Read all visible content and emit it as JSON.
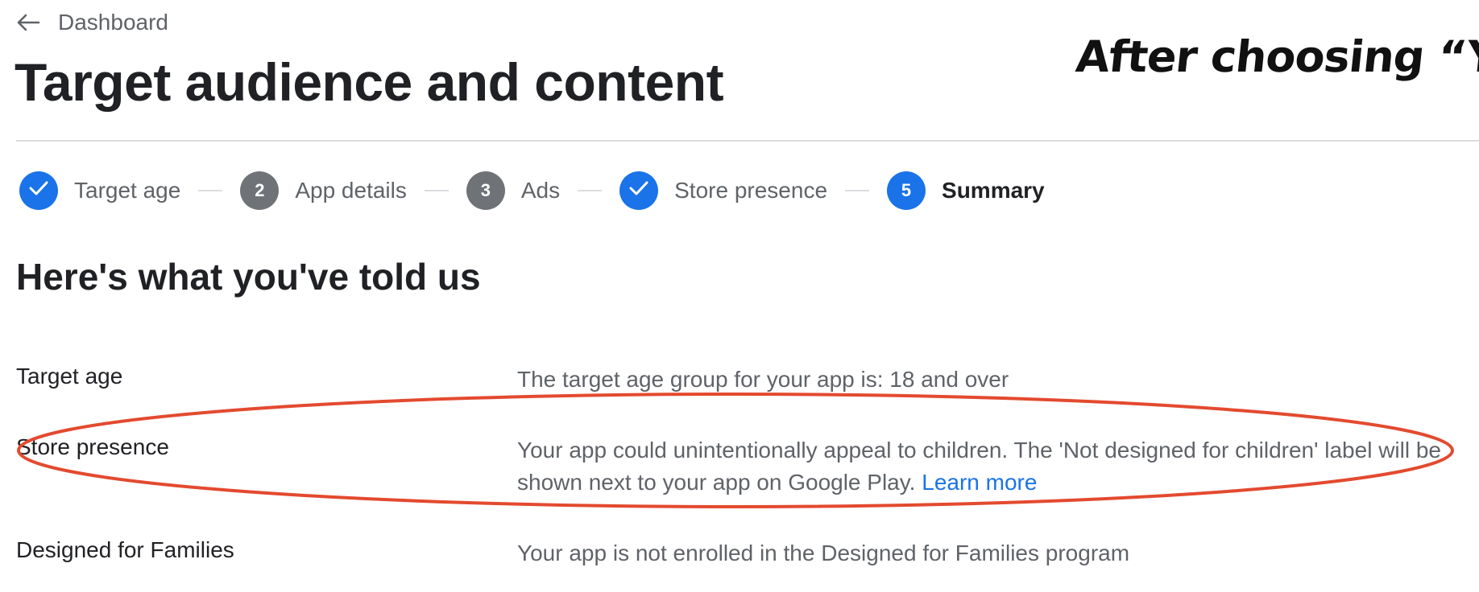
{
  "header": {
    "back_label": "Dashboard",
    "title": "Target audience and content"
  },
  "annotation": {
    "text": "After choosing “Yes”",
    "highlight_color": "#e34a2f"
  },
  "stepper": {
    "steps": [
      {
        "number": "",
        "label": "Target age",
        "state": "done",
        "icon": "check-icon"
      },
      {
        "number": "2",
        "label": "App details",
        "state": "todo"
      },
      {
        "number": "3",
        "label": "Ads",
        "state": "todo"
      },
      {
        "number": "",
        "label": "Store presence",
        "state": "done",
        "icon": "check-icon"
      },
      {
        "number": "5",
        "label": "Summary",
        "state": "current"
      }
    ]
  },
  "summary": {
    "title": "Here's what you've told us",
    "rows": [
      {
        "label": "Target age",
        "value": "The target age group for your app is: 18 and over"
      },
      {
        "label": "Store presence",
        "value": "Your app could unintentionally appeal to children. The 'Not designed for children' label will be shown next to your app on Google Play.",
        "link": "Learn more"
      },
      {
        "label": "Designed for Families",
        "value": "Your app is not enrolled in the Designed for Families program"
      }
    ]
  },
  "colors": {
    "accent": "#1a73e8",
    "step_todo": "#6f7378",
    "text_primary": "#202124",
    "text_secondary": "#5f6368",
    "divider": "#dadce0"
  }
}
